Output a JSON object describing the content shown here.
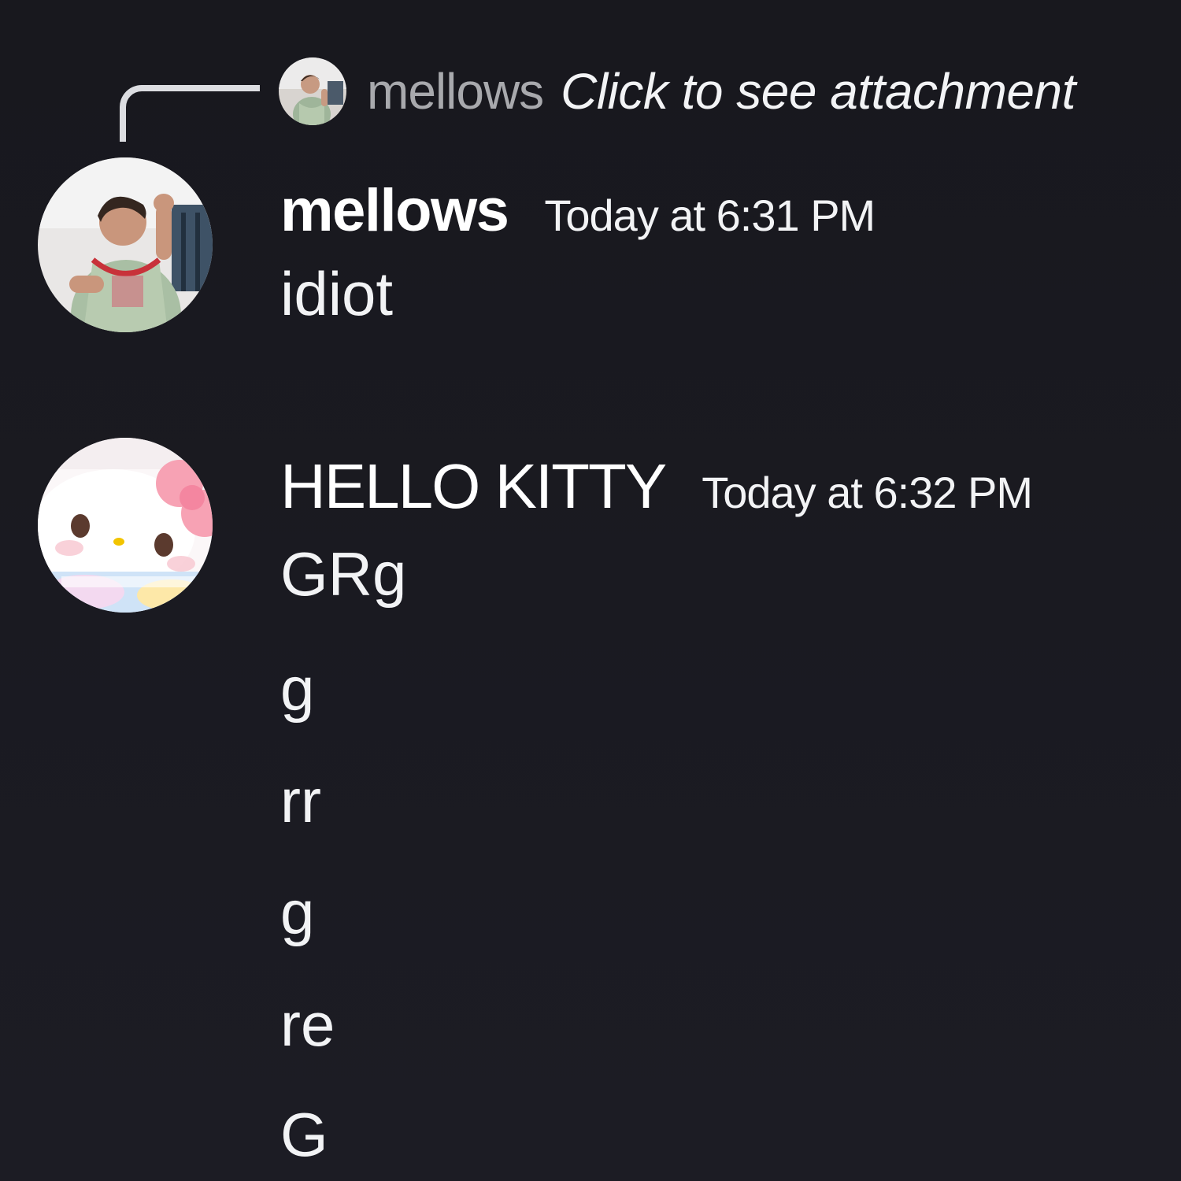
{
  "reply": {
    "username": "mellows",
    "preview_text": "Click to see attachment"
  },
  "messages": [
    {
      "username": "mellows",
      "timestamp": "Today at 6:31 PM",
      "lines": [
        "idiot"
      ]
    },
    {
      "username": "HELLO KITTY",
      "timestamp": "Today at 6:32 PM",
      "lines": [
        "GRg",
        "g",
        "rr",
        "g",
        "re",
        "G"
      ]
    }
  ]
}
